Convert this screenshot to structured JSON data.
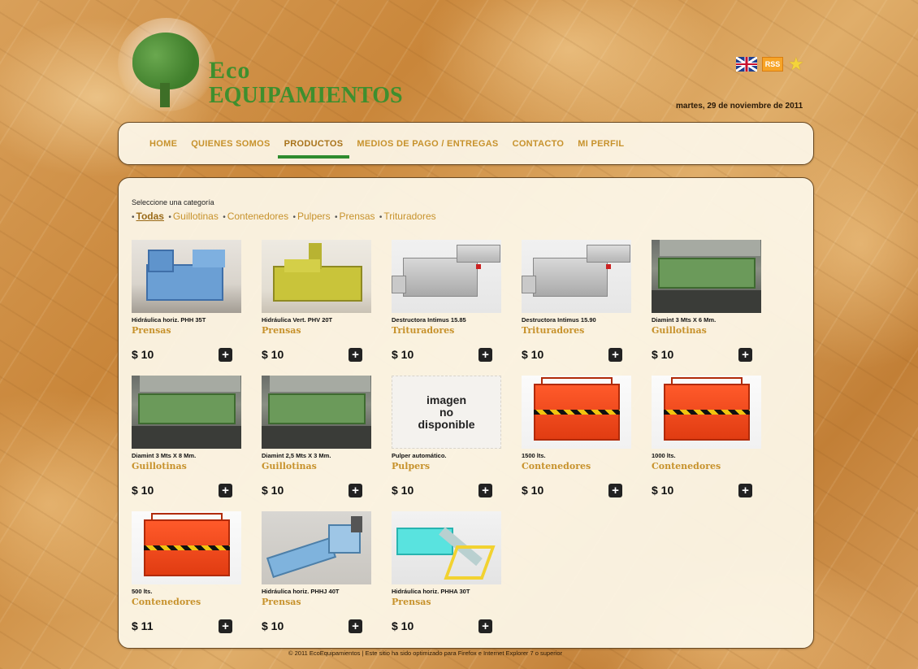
{
  "header": {
    "logo_line1": "Eco",
    "logo_line2": "Equipamientos",
    "date": "martes, 29 de noviembre de 2011",
    "icons": [
      "uk-flag-icon",
      "rss-icon",
      "star-icon"
    ],
    "rss_label": "RSS"
  },
  "nav": {
    "items": [
      {
        "label": "HOME"
      },
      {
        "label": "QUIENES SOMOS"
      },
      {
        "label": "PRODUCTOS"
      },
      {
        "label": "MEDIOS DE PAGO / ENTREGAS"
      },
      {
        "label": "CONTACTO"
      },
      {
        "label": "MI PERFIL"
      }
    ],
    "active_index": 2
  },
  "categories": {
    "prompt": "Seleccione una categoría",
    "items": [
      {
        "label": "Todas"
      },
      {
        "label": "Guillotinas"
      },
      {
        "label": "Contenedores"
      },
      {
        "label": "Pulpers"
      },
      {
        "label": "Prensas"
      },
      {
        "label": "Trituradores"
      }
    ],
    "selected": "Todas"
  },
  "products": [
    {
      "name": "Hidráulica horiz. PHH 35T",
      "category": "Prensas",
      "price": "$ 10"
    },
    {
      "name": "Hidráulica Vert. PHV 20T",
      "category": "Prensas",
      "price": "$ 10"
    },
    {
      "name": "Destructora Intimus 15.85",
      "category": "Trituradores",
      "price": "$ 10"
    },
    {
      "name": "Destructora Intimus 15.90",
      "category": "Trituradores",
      "price": "$ 10"
    },
    {
      "name": "Diamint 3 Mts X 6 Mm.",
      "category": "Guillotinas",
      "price": "$ 10"
    },
    {
      "name": "Diamint 3 Mts X 8 Mm.",
      "category": "Guillotinas",
      "price": "$ 10"
    },
    {
      "name": "Diamint 2,5 Mts X 3 Mm.",
      "category": "Guillotinas",
      "price": "$ 10"
    },
    {
      "name": "Pulper automático.",
      "category": "Pulpers",
      "price": "$ 10",
      "placeholder": [
        "imagen",
        "no",
        "disponible"
      ]
    },
    {
      "name": "1500 lts.",
      "category": "Contenedores",
      "price": "$ 10"
    },
    {
      "name": "1000 lts.",
      "category": "Contenedores",
      "price": "$ 10"
    },
    {
      "name": "500 lts.",
      "category": "Contenedores",
      "price": "$ 11"
    },
    {
      "name": "Hidráulica horiz. PHHJ 40T",
      "category": "Prensas",
      "price": "$ 10"
    },
    {
      "name": "Hidráulica horiz. PHHA 30T",
      "category": "Prensas",
      "price": "$ 10"
    }
  ],
  "add_button_label": "+",
  "footer": {
    "text": "© 2011 EcoEquipamientos | Este sitio ha sido optimizado para Firefox e Internet Explorer 7 o superior"
  }
}
